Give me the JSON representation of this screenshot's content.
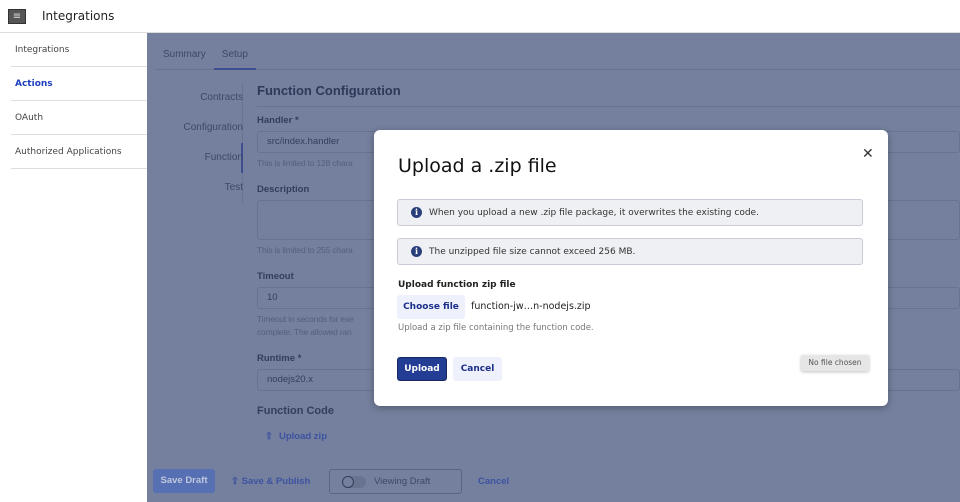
{
  "header": {
    "title": "Integrations",
    "menu_icon": "hamburger-icon"
  },
  "sidebar": {
    "items": [
      {
        "label": "Integrations"
      },
      {
        "label": "Actions",
        "active": true
      },
      {
        "label": "OAuth"
      },
      {
        "label": "Authorized Applications"
      }
    ]
  },
  "tabs": [
    {
      "label": "Summary"
    },
    {
      "label": "Setup",
      "active": true
    }
  ],
  "subnav": [
    {
      "label": "Contracts"
    },
    {
      "label": "Configuration"
    },
    {
      "label": "Function",
      "active": true
    },
    {
      "label": "Test"
    }
  ],
  "form": {
    "title": "Function Configuration",
    "handler_label": "Handler *",
    "handler_value": "src/index.handler",
    "handler_hint": "This is limited to 128 chara",
    "description_label": "Description",
    "description_value": "",
    "description_hint": "This is limited to 255 chara",
    "timeout_label": "Timeout",
    "timeout_value": "10",
    "timeout_hint_1": "Timeout in seconds for exe",
    "timeout_hint_2": "complete. The allowed ran",
    "runtime_label": "Runtime *",
    "runtime_value": "nodejs20.x",
    "code_label": "Function Code",
    "upload_zip": "Upload zip"
  },
  "footer": {
    "save_draft": "Save Draft",
    "save_publish": "Save & Publish",
    "viewing_draft": "Viewing Draft",
    "viewing_draft_on": false,
    "cancel": "Cancel"
  },
  "modal": {
    "title": "Upload a .zip file",
    "alerts": [
      "When you upload a new .zip file package, it overwrites the existing code.",
      "The unzipped file size cannot exceed 256 MB."
    ],
    "upload_label": "Upload function zip file",
    "choose_file": "Choose file",
    "file_name": "function-jw…n-nodejs.zip",
    "upload_hint": "Upload a zip file containing the function code.",
    "upload": "Upload",
    "cancel": "Cancel",
    "tooltip": "No file chosen"
  },
  "colors": {
    "accent": "#223d93",
    "link": "#1e3fbf"
  }
}
